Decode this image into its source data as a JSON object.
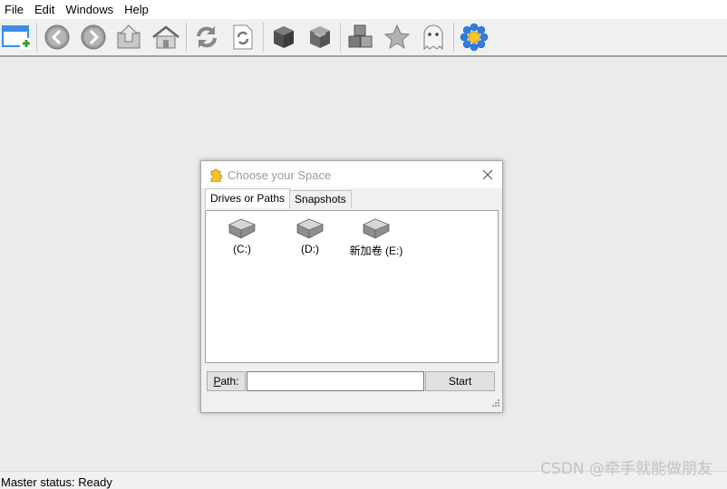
{
  "menu": [
    "File",
    "Edit",
    "Windows",
    "Help"
  ],
  "toolbar": {
    "buttons": [
      {
        "name": "new-window-icon",
        "color": "#3a8ee6"
      },
      {
        "name": "back-icon"
      },
      {
        "name": "forward-icon"
      },
      {
        "name": "up-folder-icon"
      },
      {
        "name": "home-icon"
      },
      {
        "name": "refresh-icon"
      },
      {
        "name": "refresh-document-icon"
      },
      {
        "name": "cube-dark-icon"
      },
      {
        "name": "cube-light-icon"
      },
      {
        "name": "blocks-icon"
      },
      {
        "name": "star-icon"
      },
      {
        "name": "ghost-icon"
      },
      {
        "name": "flower-icon",
        "color": "#2f7de1"
      }
    ]
  },
  "dialog": {
    "title": "Choose your Space",
    "tabs": [
      "Drives or Paths",
      "Snapshots"
    ],
    "active_tab": "Drives or Paths",
    "drives": [
      "(C:)",
      "(D:)",
      "新加卷 (E:)"
    ],
    "path_label_prefix": "P",
    "path_label_rest": "ath:",
    "path_value": "",
    "start_label": "Start"
  },
  "status": {
    "text": "Master status: Ready"
  },
  "watermark": "CSDN @牵手就能做朋友"
}
